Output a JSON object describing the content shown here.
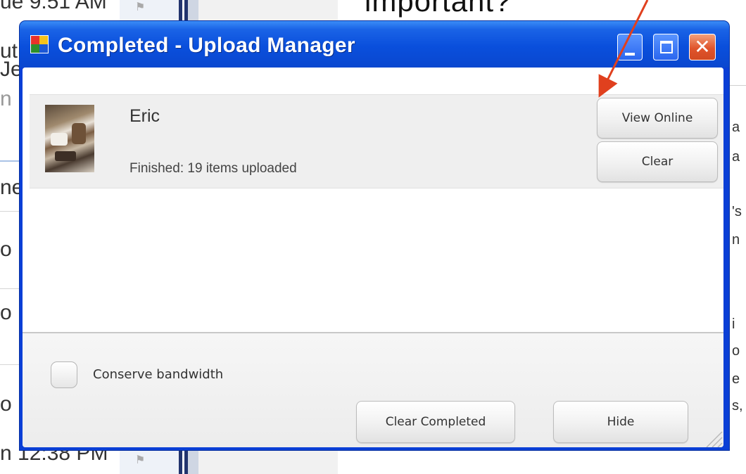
{
  "window": {
    "title": "Completed - Upload Manager"
  },
  "upload_items": [
    {
      "name": "Eric",
      "status": "Finished: 19 items uploaded",
      "view_online_label": "View Online",
      "clear_label": "Clear"
    }
  ],
  "footer": {
    "conserve_bandwidth_label": "Conserve bandwidth",
    "conserve_bandwidth_checked": false,
    "clear_completed_label": "Clear Completed",
    "hide_label": "Hide"
  },
  "background": {
    "heading_fragment": "important?",
    "left_time_top": "ue 9:51 AM",
    "left_time_bottom": "n 12:38 PM",
    "left_fragments": [
      "ut",
      "Je",
      "n",
      "ne",
      "o",
      "o",
      "o"
    ],
    "right_fragments": [
      "a",
      "a",
      "'s",
      "n",
      "i",
      "o",
      "e",
      "s,"
    ]
  },
  "annotation": {
    "arrow_color": "#e0401e"
  },
  "colors": {
    "titlebar": "#0a4fdc",
    "close_button": "#e0542c"
  }
}
